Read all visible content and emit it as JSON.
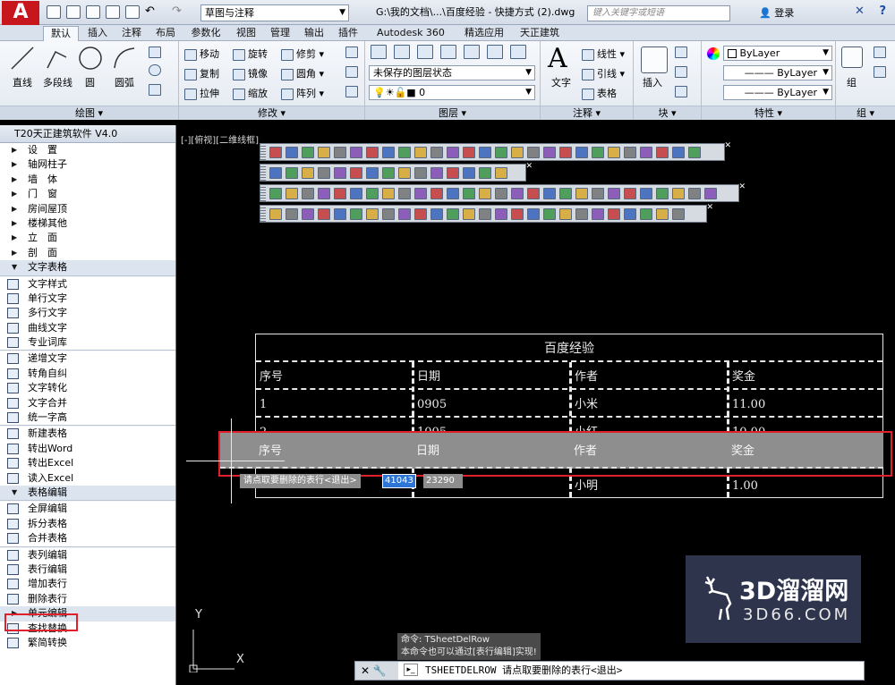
{
  "app": {
    "logo": "A",
    "workspace": "草图与注释",
    "document_title": "G:\\我的文档\\...\\百度经验 - 快捷方式 (2).dwg",
    "help_search_placeholder": "键入关键字或短语",
    "login": "登录"
  },
  "ribbon_tabs": [
    "默认",
    "插入",
    "注释",
    "布局",
    "参数化",
    "视图",
    "管理",
    "输出",
    "插件",
    "Autodesk 360",
    "精选应用",
    "天正建筑"
  ],
  "ribbon": {
    "draw": {
      "title": "绘图",
      "line": "直线",
      "polyline": "多段线",
      "circle": "圆",
      "arc": "圆弧"
    },
    "modify": {
      "title": "修改",
      "move": "移动",
      "rotate": "旋转",
      "trim": "修剪",
      "copy": "复制",
      "mirror": "镜像",
      "fillet": "圆角",
      "stretch": "拉伸",
      "scale": "缩放",
      "array": "阵列"
    },
    "layers": {
      "title": "图层",
      "layer_state": "未保存的图层状态",
      "current_layer": "0"
    },
    "annotation": {
      "title": "注释",
      "text": "文字",
      "linear": "线性",
      "leader": "引线",
      "table": "表格"
    },
    "block": {
      "title": "块",
      "insert": "插入"
    },
    "properties": {
      "title": "特性",
      "color": "ByLayer",
      "linetype": "ByLayer",
      "lineweight": "ByLayer"
    },
    "groups": {
      "title": "组",
      "group": "组"
    }
  },
  "palette": {
    "title": "T20天正建筑软件 V4.0",
    "sections": [
      "设　置",
      "轴网柱子",
      "墙　体",
      "门　窗",
      "房间屋顶",
      "楼梯其他",
      "立　面",
      "剖　面",
      "文字表格"
    ],
    "text_tools": [
      "文字样式",
      "单行文字",
      "多行文字",
      "曲线文字",
      "专业词库"
    ],
    "text_edit": [
      "递增文字",
      "转角自纠",
      "文字转化",
      "文字合并",
      "统一字高"
    ],
    "table_tools": [
      "新建表格",
      "转出Word",
      "转出Excel",
      "读入Excel",
      "表格编辑"
    ],
    "table_edit": [
      "全屏编辑",
      "拆分表格",
      "合并表格"
    ],
    "row_col": [
      "表列编辑",
      "表行编辑",
      "增加表行",
      "删除表行"
    ],
    "more": [
      "单元编辑",
      "查找替换",
      "繁简转换"
    ]
  },
  "viewport_label": "[-][俯视][二维线框]",
  "drawing_table": {
    "title": "百度经验",
    "headers": [
      "序号",
      "日期",
      "作者",
      "奖金"
    ],
    "rows": [
      [
        "1",
        "0905",
        "小米",
        "11.00"
      ],
      [
        "2",
        "1005",
        "小红",
        "10.00"
      ],
      [
        "",
        "",
        "小明",
        "1.00"
      ]
    ],
    "ghost_row": [
      "序号",
      "日期",
      "作者",
      "奖金"
    ]
  },
  "prompt": {
    "tooltip": "请点取要删除的表行<退出>",
    "x": "41043",
    "y": "23290"
  },
  "ucs": {
    "y": "Y",
    "x": "X"
  },
  "command": {
    "history_1": "命令: TSheetDelRow",
    "history_2": "本命令也可以通过[表行编辑]实现!",
    "current": "TSHEETDELROW 请点取要删除的表行<退出>"
  },
  "watermark": {
    "name": "3D溜溜网",
    "url": "3D66.COM"
  }
}
